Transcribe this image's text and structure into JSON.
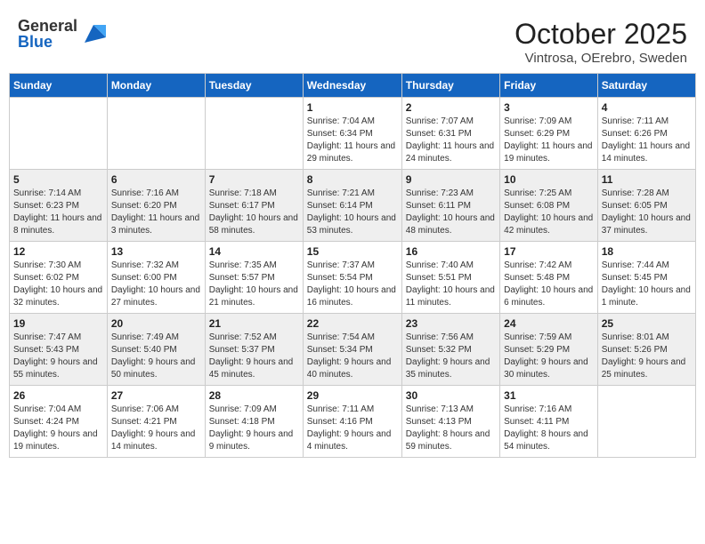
{
  "header": {
    "logo_general": "General",
    "logo_blue": "Blue",
    "month": "October 2025",
    "location": "Vintrosa, OErebro, Sweden"
  },
  "weekdays": [
    "Sunday",
    "Monday",
    "Tuesday",
    "Wednesday",
    "Thursday",
    "Friday",
    "Saturday"
  ],
  "weeks": [
    [
      {
        "day": "",
        "info": ""
      },
      {
        "day": "",
        "info": ""
      },
      {
        "day": "",
        "info": ""
      },
      {
        "day": "1",
        "info": "Sunrise: 7:04 AM\nSunset: 6:34 PM\nDaylight: 11 hours and 29 minutes."
      },
      {
        "day": "2",
        "info": "Sunrise: 7:07 AM\nSunset: 6:31 PM\nDaylight: 11 hours and 24 minutes."
      },
      {
        "day": "3",
        "info": "Sunrise: 7:09 AM\nSunset: 6:29 PM\nDaylight: 11 hours and 19 minutes."
      },
      {
        "day": "4",
        "info": "Sunrise: 7:11 AM\nSunset: 6:26 PM\nDaylight: 11 hours and 14 minutes."
      }
    ],
    [
      {
        "day": "5",
        "info": "Sunrise: 7:14 AM\nSunset: 6:23 PM\nDaylight: 11 hours and 8 minutes."
      },
      {
        "day": "6",
        "info": "Sunrise: 7:16 AM\nSunset: 6:20 PM\nDaylight: 11 hours and 3 minutes."
      },
      {
        "day": "7",
        "info": "Sunrise: 7:18 AM\nSunset: 6:17 PM\nDaylight: 10 hours and 58 minutes."
      },
      {
        "day": "8",
        "info": "Sunrise: 7:21 AM\nSunset: 6:14 PM\nDaylight: 10 hours and 53 minutes."
      },
      {
        "day": "9",
        "info": "Sunrise: 7:23 AM\nSunset: 6:11 PM\nDaylight: 10 hours and 48 minutes."
      },
      {
        "day": "10",
        "info": "Sunrise: 7:25 AM\nSunset: 6:08 PM\nDaylight: 10 hours and 42 minutes."
      },
      {
        "day": "11",
        "info": "Sunrise: 7:28 AM\nSunset: 6:05 PM\nDaylight: 10 hours and 37 minutes."
      }
    ],
    [
      {
        "day": "12",
        "info": "Sunrise: 7:30 AM\nSunset: 6:02 PM\nDaylight: 10 hours and 32 minutes."
      },
      {
        "day": "13",
        "info": "Sunrise: 7:32 AM\nSunset: 6:00 PM\nDaylight: 10 hours and 27 minutes."
      },
      {
        "day": "14",
        "info": "Sunrise: 7:35 AM\nSunset: 5:57 PM\nDaylight: 10 hours and 21 minutes."
      },
      {
        "day": "15",
        "info": "Sunrise: 7:37 AM\nSunset: 5:54 PM\nDaylight: 10 hours and 16 minutes."
      },
      {
        "day": "16",
        "info": "Sunrise: 7:40 AM\nSunset: 5:51 PM\nDaylight: 10 hours and 11 minutes."
      },
      {
        "day": "17",
        "info": "Sunrise: 7:42 AM\nSunset: 5:48 PM\nDaylight: 10 hours and 6 minutes."
      },
      {
        "day": "18",
        "info": "Sunrise: 7:44 AM\nSunset: 5:45 PM\nDaylight: 10 hours and 1 minute."
      }
    ],
    [
      {
        "day": "19",
        "info": "Sunrise: 7:47 AM\nSunset: 5:43 PM\nDaylight: 9 hours and 55 minutes."
      },
      {
        "day": "20",
        "info": "Sunrise: 7:49 AM\nSunset: 5:40 PM\nDaylight: 9 hours and 50 minutes."
      },
      {
        "day": "21",
        "info": "Sunrise: 7:52 AM\nSunset: 5:37 PM\nDaylight: 9 hours and 45 minutes."
      },
      {
        "day": "22",
        "info": "Sunrise: 7:54 AM\nSunset: 5:34 PM\nDaylight: 9 hours and 40 minutes."
      },
      {
        "day": "23",
        "info": "Sunrise: 7:56 AM\nSunset: 5:32 PM\nDaylight: 9 hours and 35 minutes."
      },
      {
        "day": "24",
        "info": "Sunrise: 7:59 AM\nSunset: 5:29 PM\nDaylight: 9 hours and 30 minutes."
      },
      {
        "day": "25",
        "info": "Sunrise: 8:01 AM\nSunset: 5:26 PM\nDaylight: 9 hours and 25 minutes."
      }
    ],
    [
      {
        "day": "26",
        "info": "Sunrise: 7:04 AM\nSunset: 4:24 PM\nDaylight: 9 hours and 19 minutes."
      },
      {
        "day": "27",
        "info": "Sunrise: 7:06 AM\nSunset: 4:21 PM\nDaylight: 9 hours and 14 minutes."
      },
      {
        "day": "28",
        "info": "Sunrise: 7:09 AM\nSunset: 4:18 PM\nDaylight: 9 hours and 9 minutes."
      },
      {
        "day": "29",
        "info": "Sunrise: 7:11 AM\nSunset: 4:16 PM\nDaylight: 9 hours and 4 minutes."
      },
      {
        "day": "30",
        "info": "Sunrise: 7:13 AM\nSunset: 4:13 PM\nDaylight: 8 hours and 59 minutes."
      },
      {
        "day": "31",
        "info": "Sunrise: 7:16 AM\nSunset: 4:11 PM\nDaylight: 8 hours and 54 minutes."
      },
      {
        "day": "",
        "info": ""
      }
    ]
  ]
}
